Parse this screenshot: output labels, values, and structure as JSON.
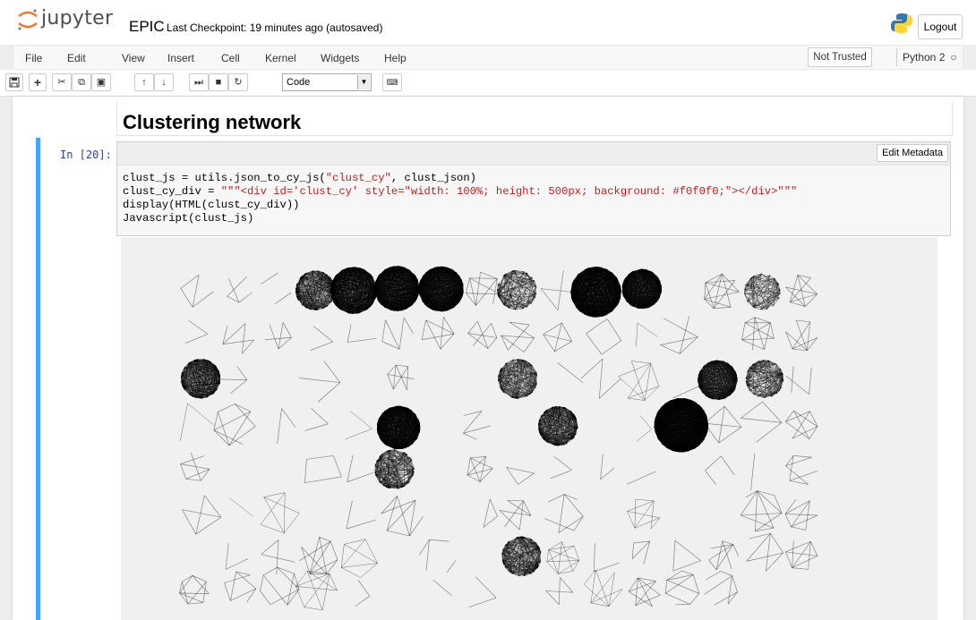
{
  "header": {
    "logo_text": "jupyter",
    "notebook_name": "EPIC",
    "checkpoint": "Last Checkpoint: 19 minutes ago (autosaved)",
    "logout_label": "Logout"
  },
  "menubar": {
    "items": [
      "File",
      "Edit",
      "View",
      "Insert",
      "Cell",
      "Kernel",
      "Widgets",
      "Help"
    ],
    "trust_label": "Not Trusted",
    "kernel_name": "Python 2"
  },
  "toolbar": {
    "icons": [
      "save-icon",
      "add-cell-icon",
      "cut-icon",
      "copy-icon",
      "paste-icon",
      "move-up-icon",
      "move-down-icon",
      "run-icon",
      "stop-icon",
      "restart-icon"
    ],
    "cell_type": "Code",
    "cell_type_options_visible": [
      "Code"
    ]
  },
  "markdown_cell": {
    "heading": "Clustering network"
  },
  "code_cell": {
    "prompt": "In [20]:",
    "edit_metadata_label": "Edit Metadata",
    "code": {
      "line1_a": "clust_js = utils.json_to_cy_js(",
      "line1_s1": "\"clust_cy\"",
      "line1_b": ", clust_json)",
      "line2_a": "clust_cy_div = ",
      "line2_s": "\"\"\"<div id='clust_cy' style=\"width: 100%; height: 500px; background: #f0f0f0;\"></div>\"\"\"",
      "line3": "display(HTML(clust_cy_div))",
      "line4": "Javascript(clust_js)"
    }
  },
  "output": {
    "background": "#f0f0f0",
    "description_clusters": "network clusters (dense and sparse)"
  },
  "colors": {
    "accent_cell_border": "#42a5f5",
    "prompt_color": "#303f9f",
    "string_color": "#ba2121"
  }
}
